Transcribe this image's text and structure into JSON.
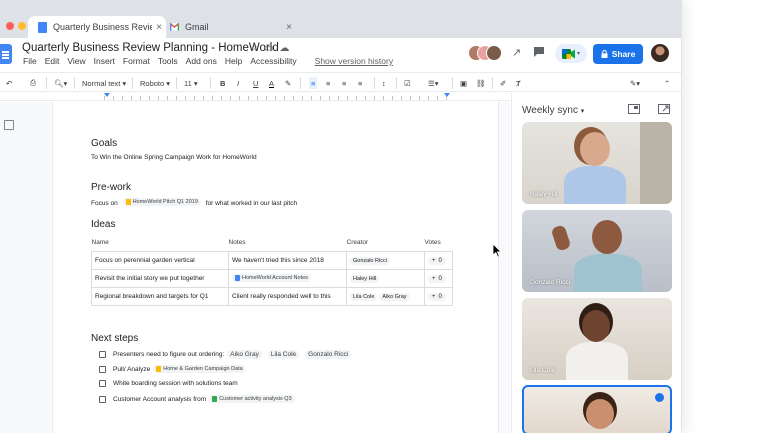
{
  "browser": {
    "tabs": [
      {
        "label": "Quarterly Business Review Plann",
        "active": true
      },
      {
        "label": "Gmail",
        "active": false
      }
    ],
    "close_glyph": "×"
  },
  "doc": {
    "title": "Quarterly Business Review Planning - HomeWorld",
    "menu": [
      "File",
      "Edit",
      "View",
      "Insert",
      "Format",
      "Tools",
      "Add ons",
      "Help",
      "Accessibility"
    ],
    "version_history": "Show version history",
    "share_label": "Share"
  },
  "toolbar": {
    "zoom": "",
    "style": "Normal text",
    "font": "Roboto",
    "size": "11",
    "bold": "B",
    "italic": "I",
    "underline": "U",
    "text_color": "A"
  },
  "content": {
    "goals_heading": "Goals",
    "goals_text": "To Win the Online Spring Campaign Work for HomeWorld",
    "prework_heading": "Pre-work",
    "prework_prefix": "Focus on",
    "prework_chip": "HomeWorld Pitch Q1 2019",
    "prework_suffix": "for what worked in our last pitch",
    "ideas_heading": "Ideas",
    "ideas_columns": [
      "Name",
      "Notes",
      "Creator",
      "Votes"
    ],
    "ideas_rows": [
      {
        "name": "Focus on perennial garden vertical",
        "notes": "We haven't tried this since 2018",
        "creators": [
          "Gonzalo Ricci"
        ],
        "votes": "0"
      },
      {
        "name": "Revisit the initial story we put together",
        "notes": "HomeWorld Account Notes",
        "creators": [
          "Haley Hill"
        ],
        "votes": "0"
      },
      {
        "name": "Regional breakdown and targets for Q1",
        "notes": "Client really responded well to this",
        "creators": [
          "Lila Cole",
          "Aiko Gray"
        ],
        "votes": "0"
      }
    ],
    "next_heading": "Next steps",
    "tasks": [
      {
        "text": "Presenters need to figure out ordering:",
        "chips": [
          "Aiko Gray",
          "Lila Cole",
          "Gonzalo Ricci"
        ]
      },
      {
        "text": "Pull/ Analyze",
        "chips": [
          "Home & Garden Campaign Data"
        ]
      },
      {
        "text": "White boarding session with solutions team",
        "chips": []
      },
      {
        "text": "Customer Account analysis from",
        "chips": [
          "Customer activity analysis Q3"
        ]
      }
    ]
  },
  "meet": {
    "title": "Weekly sync",
    "participants": [
      "Haley Hill",
      "Gonzalo Ricci",
      "Lila Cole",
      ""
    ]
  },
  "colors": {
    "accent": "#1a73e8",
    "docs_blue": "#4285f4",
    "chip_bg": "#f1f3f4"
  },
  "icons": [
    "docs-tab-icon",
    "gmail-icon",
    "star-icon",
    "move-icon",
    "cloud-icon",
    "trend-icon",
    "comment-icon",
    "meet-icon",
    "lock-icon",
    "pip-icon",
    "popout-icon",
    "outline-icon"
  ]
}
